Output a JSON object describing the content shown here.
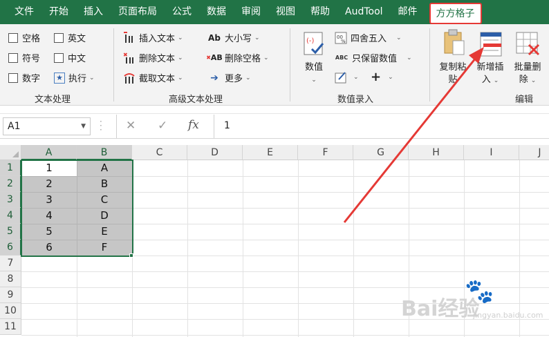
{
  "tabs": [
    "文件",
    "开始",
    "插入",
    "页面布局",
    "公式",
    "数据",
    "审阅",
    "视图",
    "帮助",
    "AudTool",
    "邮件",
    "方方格子"
  ],
  "active_tab": "方方格子",
  "ribbon": {
    "text_group": {
      "label": "文本处理",
      "checks": [
        "空格",
        "英文",
        "符号",
        "中文",
        "数字"
      ],
      "exec_label": "执行"
    },
    "adv_group": {
      "label": "高级文本处理",
      "insert_text": "插入文本",
      "delete_text": "删除文本",
      "cut_text": "截取文本",
      "case": "大小写",
      "del_space": "删除空格",
      "more": "更多"
    },
    "num_group": {
      "label": "数值录入",
      "value": "数值",
      "round": "四舍五入",
      "keep_num": "只保留数值",
      "plus": "+"
    },
    "edit_group": {
      "label": "编辑",
      "copy_paste_l1": "复制粘",
      "copy_paste_l2": "贴",
      "insert_l1": "新增插",
      "insert_l2": "入",
      "batch_del_l1": "批量删",
      "batch_del_l2": "除"
    }
  },
  "formula_bar": {
    "name_box": "A1",
    "value": "1",
    "fx": "fx"
  },
  "sheet": {
    "columns": [
      "A",
      "B",
      "C",
      "D",
      "E",
      "F",
      "G",
      "H",
      "I",
      "J"
    ],
    "rows": [
      "1",
      "2",
      "3",
      "4",
      "5",
      "6",
      "7",
      "8",
      "9",
      "10",
      "11"
    ],
    "col_a": [
      "1",
      "2",
      "3",
      "4",
      "5",
      "6"
    ],
    "col_b": [
      "A",
      "B",
      "C",
      "D",
      "E",
      "F"
    ]
  },
  "watermark": {
    "brand": "Bai经验",
    "sub": "jingyan.baidu.com"
  },
  "colors": {
    "excel_green": "#217346",
    "highlight_red": "#e53935",
    "selection_gray": "#c6c6c6"
  }
}
